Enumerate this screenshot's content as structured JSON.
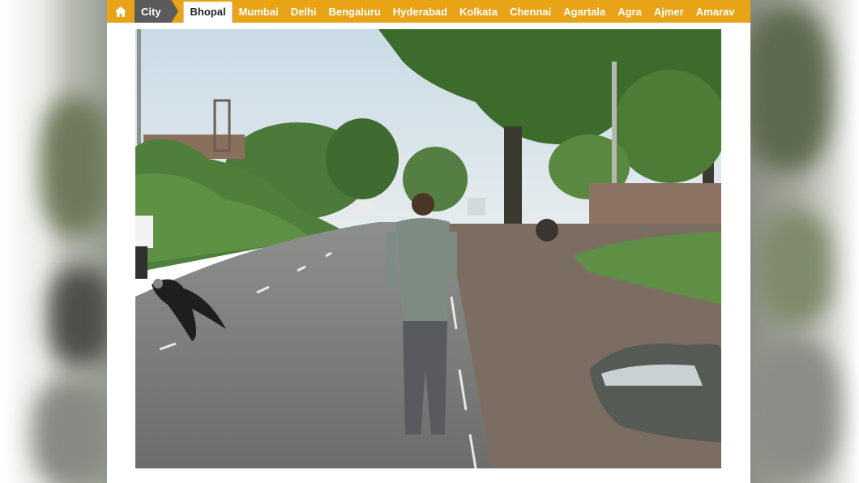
{
  "colors": {
    "navbar_bg": "#e8a317",
    "city_bg": "#5b5b5b",
    "active_bg": "#ffffff"
  },
  "navbar": {
    "home_icon": "home-icon",
    "section_label": "City",
    "active_city": "Bhopal",
    "cities": [
      "Bhopal",
      "Mumbai",
      "Delhi",
      "Bengaluru",
      "Hyderabad",
      "Kolkata",
      "Chennai",
      "Agartala",
      "Agra",
      "Ajmer",
      "Amarav"
    ]
  }
}
